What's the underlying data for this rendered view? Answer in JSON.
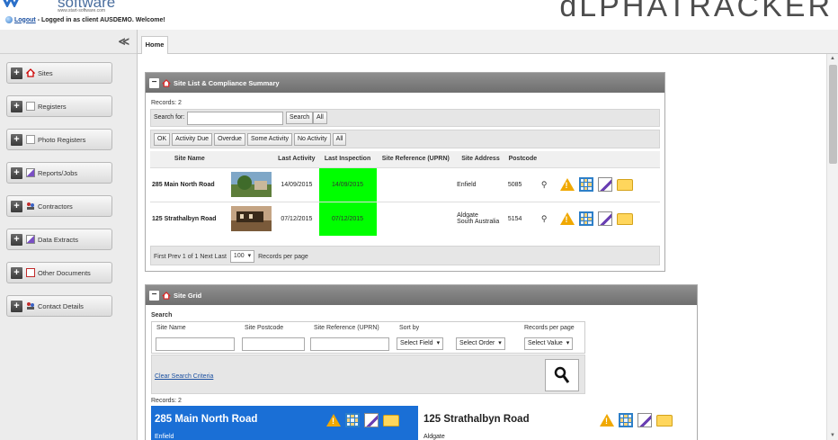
{
  "header": {
    "logo_word": "software",
    "logo_url": "www.start-software.com",
    "logout_label": "Logout",
    "login_text": "- Logged in as client AUSDEMO. Welcome!",
    "brand": "ɑLPHATRACKER"
  },
  "sidebar": {
    "collapse_glyph": "≪",
    "items": [
      {
        "label": "Sites",
        "icon": "house-icon"
      },
      {
        "label": "Registers",
        "icon": "register-icon"
      },
      {
        "label": "Photo Registers",
        "icon": "photo-register-icon"
      },
      {
        "label": "Reports/Jobs",
        "icon": "reports-icon"
      },
      {
        "label": "Contractors",
        "icon": "contractors-icon"
      },
      {
        "label": "Data Extracts",
        "icon": "extract-icon"
      },
      {
        "label": "Other Documents",
        "icon": "document-icon"
      },
      {
        "label": "Contact Details",
        "icon": "contacts-icon"
      }
    ]
  },
  "tabs": {
    "home": "Home"
  },
  "site_list": {
    "title": "Site List & Compliance Summary",
    "records": "Records: 2",
    "search_label": "Search for:",
    "search_value": "",
    "search_button": "Search",
    "all_button": "All",
    "filters": [
      "OK",
      "Activity Due",
      "Overdue",
      "Some Activity",
      "No Activity",
      "All"
    ],
    "columns": [
      "Site Name",
      "Last Activity",
      "Last Inspection",
      "Site Reference (UPRN)",
      "Site Address",
      "Postcode"
    ],
    "rows": [
      {
        "name": "285 Main North Road",
        "last_activity": "14/09/2015",
        "last_inspection": "14/09/2015",
        "uprn": "",
        "address_1": "Enfield",
        "address_2": "",
        "postcode": "5085"
      },
      {
        "name": "125 Strathalbyn Road",
        "last_activity": "07/12/2015",
        "last_inspection": "07/12/2015",
        "uprn": "",
        "address_1": "Aldgate",
        "address_2": "South Australia",
        "postcode": "5154"
      }
    ],
    "pager": "First Prev 1 of 1 Next Last",
    "per_page_value": "100",
    "per_page_label": "Records per page"
  },
  "site_grid": {
    "title": "Site Grid",
    "search_heading": "Search",
    "site_name_label": "Site Name",
    "site_postcode_label": "Site Postcode",
    "site_ref_label": "Site Reference (UPRN)",
    "sort_by_label": "Sort by",
    "select_field": "Select Field",
    "select_order": "Select Order",
    "records_per_page_label": "Records per page",
    "select_value": "Select Value",
    "clear_label": "Clear Search Criteria",
    "records": "Records: 2",
    "cards": [
      {
        "title": "285 Main North Road",
        "sub": "Enfield"
      },
      {
        "title": "125 Strathalbyn Road",
        "sub": "Aldgate"
      }
    ]
  },
  "colors": {
    "accent_blue": "#1a6fd6",
    "inspection_green": "#00ff00",
    "panel_header": "#7a7a7a"
  }
}
